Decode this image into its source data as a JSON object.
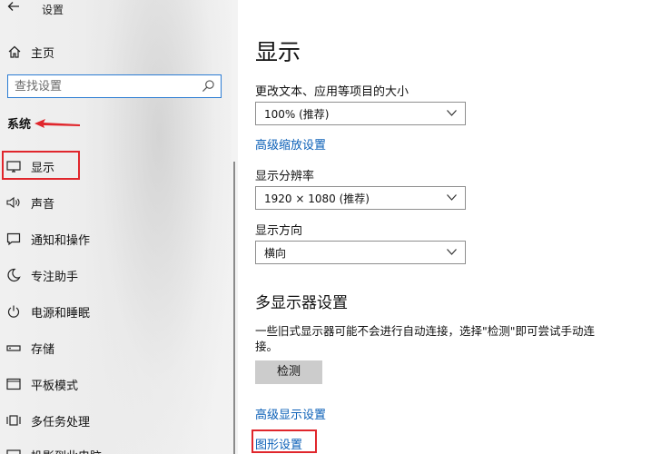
{
  "window": {
    "title": "设置"
  },
  "sidebar": {
    "home_label": "主页",
    "search_placeholder": "查找设置",
    "section_label": "系统",
    "items": [
      {
        "label": "显示",
        "icon": "monitor-icon"
      },
      {
        "label": "声音",
        "icon": "speaker-icon"
      },
      {
        "label": "通知和操作",
        "icon": "notification-icon"
      },
      {
        "label": "专注助手",
        "icon": "moon-icon"
      },
      {
        "label": "电源和睡眠",
        "icon": "power-icon"
      },
      {
        "label": "存储",
        "icon": "storage-icon"
      },
      {
        "label": "平板模式",
        "icon": "tablet-icon"
      },
      {
        "label": "多任务处理",
        "icon": "multitask-icon"
      },
      {
        "label": "投影到此电脑",
        "icon": "project-icon"
      }
    ],
    "selected_index": 0
  },
  "main": {
    "title": "显示",
    "scale_label": "更改文本、应用等项目的大小",
    "scale_value": "100% (推荐)",
    "advanced_scale_link": "高级缩放设置",
    "resolution_label": "显示分辨率",
    "resolution_value": "1920 × 1080 (推荐)",
    "orientation_label": "显示方向",
    "orientation_value": "横向",
    "multi_display_title": "多显示器设置",
    "multi_display_desc": "一些旧式显示器可能不会进行自动连接，选择\"检测\"即可尝试手动连接。",
    "detect_button": "检测",
    "advanced_display_link": "高级显示设置",
    "graphics_link": "图形设置"
  },
  "colors": {
    "accent_blue": "#2b7cd3",
    "link_blue": "#0a5fb7",
    "annotation_red": "#e0262c",
    "button_gray": "#cccccc"
  }
}
